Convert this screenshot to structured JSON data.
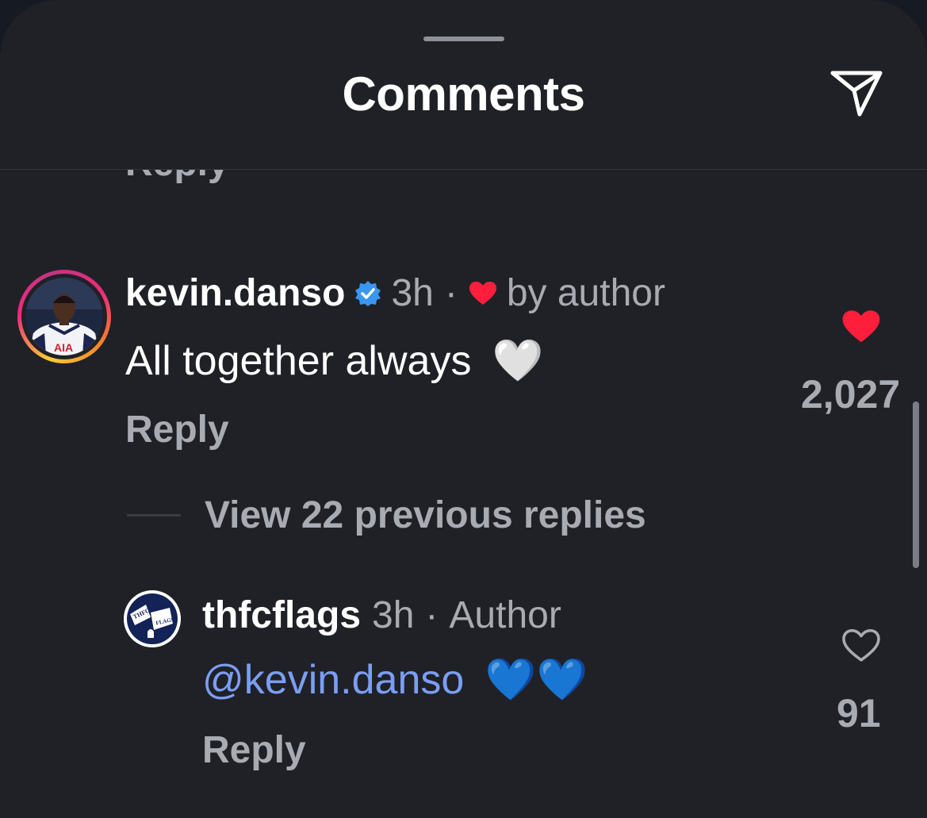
{
  "header": {
    "title": "Comments"
  },
  "previous": {
    "reply_label": "Reply"
  },
  "comments": [
    {
      "username": "kevin.danso",
      "verified": true,
      "time": "3h",
      "separator": "·",
      "liked_by_author": "by author",
      "text": "All together always",
      "emoji": "🤍",
      "reply_label": "Reply",
      "liked": true,
      "like_count": "2,027",
      "avatar_jersey_text": "AIA"
    }
  ],
  "view_replies": "View 22 previous replies",
  "replies": [
    {
      "username": "thfcflags",
      "time": "3h",
      "separator": "·",
      "role": "Author",
      "mention": "@kevin.danso",
      "emoji": "💙💙",
      "reply_label": "Reply",
      "liked": false,
      "like_count": "91",
      "avatar_text_1": "THFC",
      "avatar_text_2": "FLAGS"
    }
  ],
  "colors": {
    "sheet": "#202126",
    "muted_text": "#a8abb2",
    "mention": "#7b9ef5",
    "like_red": "#ff1f3d",
    "verified_blue": "#3897f0"
  }
}
